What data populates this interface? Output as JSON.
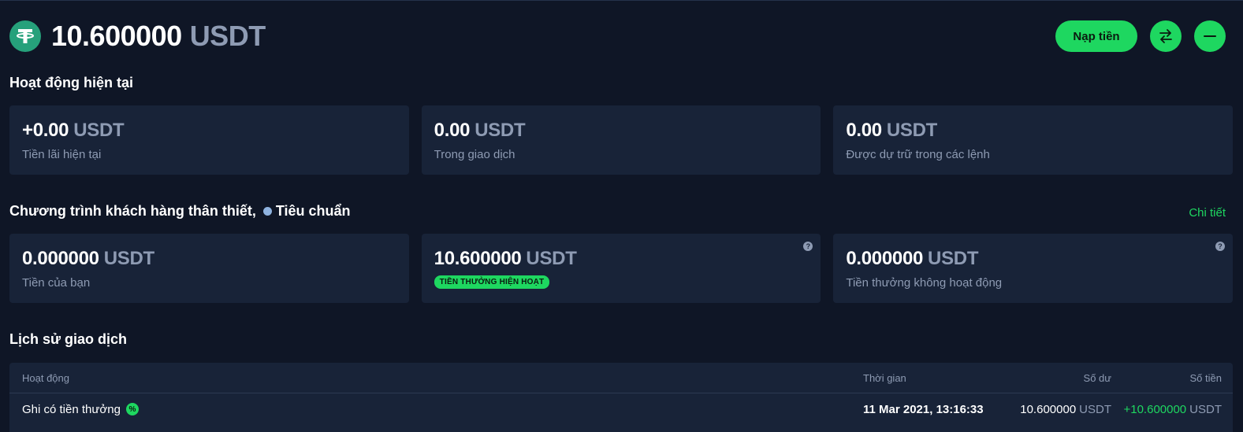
{
  "header": {
    "amount": "10.600000",
    "currency": "USDT",
    "deposit_label": "Nạp tiền",
    "icons": {
      "coin": "tether-icon",
      "swap": "swap-arrows-icon",
      "collapse": "minus-icon"
    }
  },
  "current_activity": {
    "title": "Hoạt động hiện tại",
    "cards": [
      {
        "value": "+0.00",
        "currency": "USDT",
        "label": "Tiền lãi hiện tại"
      },
      {
        "value": "0.00",
        "currency": "USDT",
        "label": "Trong giao dịch"
      },
      {
        "value": "0.00",
        "currency": "USDT",
        "label": "Được dự trữ trong các lệnh"
      }
    ]
  },
  "loyalty": {
    "title": "Chương trình khách hàng thân thiết,",
    "tier": "Tiêu chuẩn",
    "details_link": "Chi tiết",
    "cards": [
      {
        "value": "0.000000",
        "currency": "USDT",
        "label": "Tiền của bạn"
      },
      {
        "value": "10.600000",
        "currency": "USDT",
        "badge": "TIỀN THƯỞNG HIỆN HOẠT",
        "help": "?"
      },
      {
        "value": "0.000000",
        "currency": "USDT",
        "label": "Tiền thưởng không hoạt động",
        "help": "?"
      }
    ]
  },
  "history": {
    "title": "Lịch sử giao dịch",
    "columns": {
      "activity": "Hoạt động",
      "time": "Thời gian",
      "balance": "Số dư",
      "amount": "Số tiền"
    },
    "rows": [
      {
        "activity": "Ghi có tiền thưởng",
        "activity_icon": "%",
        "time": "11 Mar 2021, 13:16:33",
        "balance": "10.600000",
        "balance_currency": "USDT",
        "amount": "+10.600000",
        "amount_currency": "USDT"
      }
    ]
  },
  "colors": {
    "accent": "#1ed760",
    "background": "#0f1626",
    "card": "#182338",
    "muted": "#8e9bb3",
    "tether": "#26a17b",
    "tier_dot": "#8fb3e0"
  }
}
